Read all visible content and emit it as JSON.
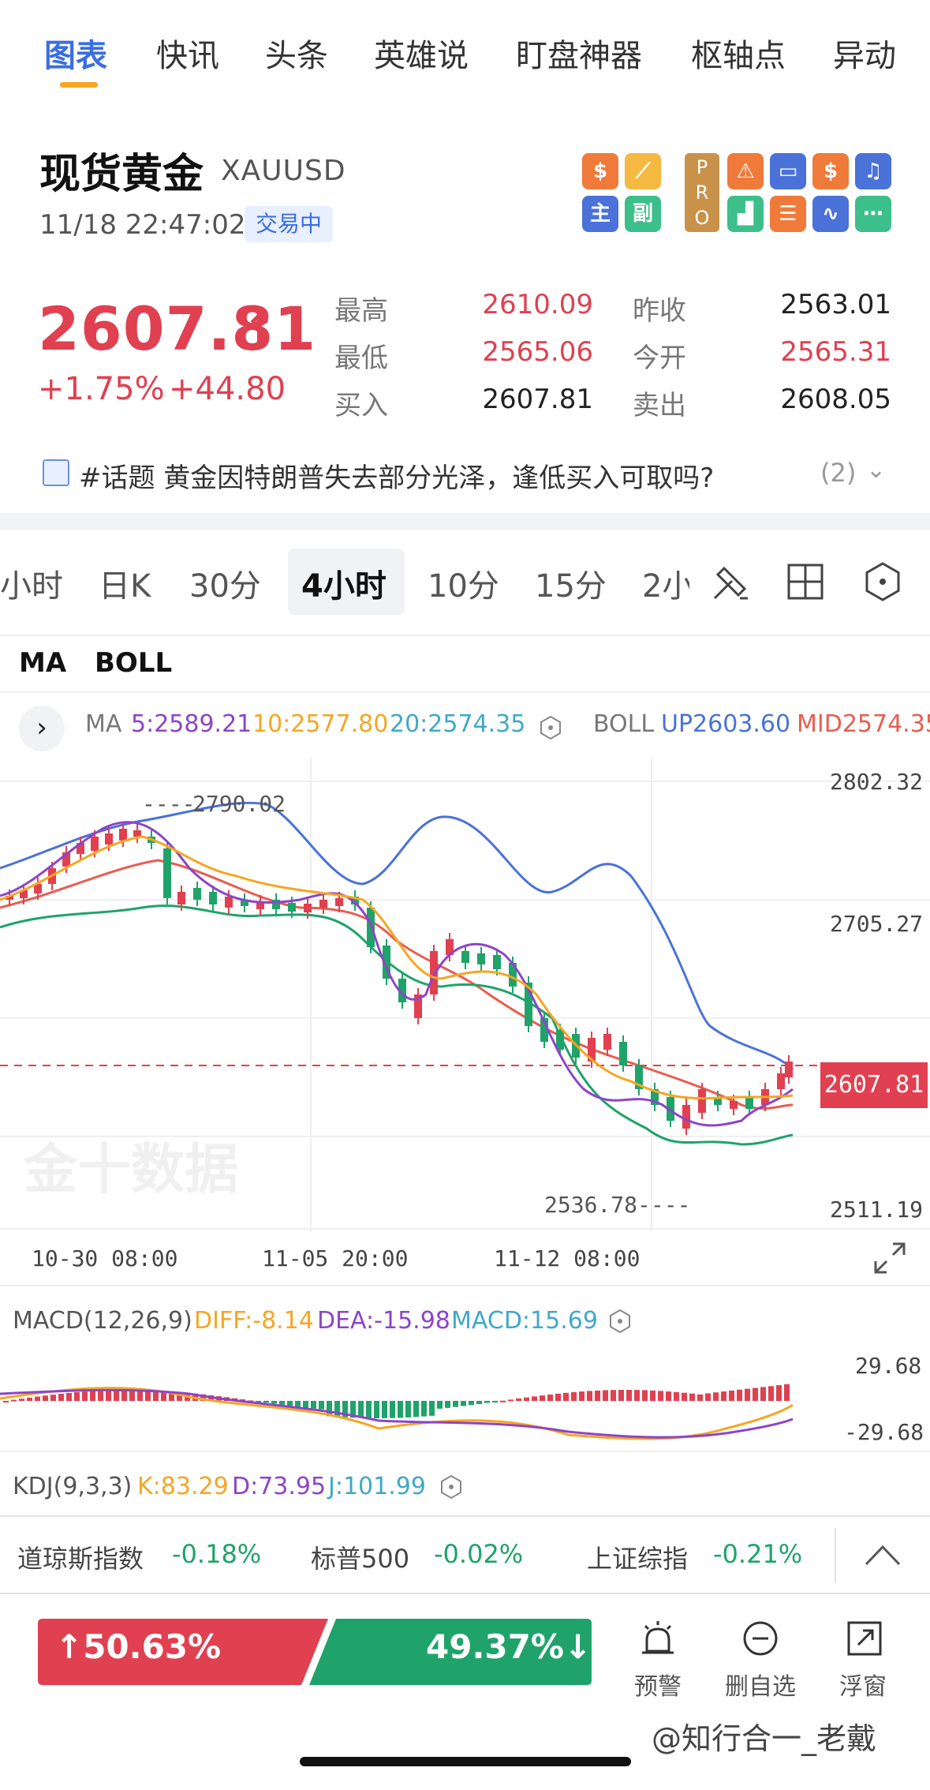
{
  "top_tabs": [
    "图表",
    "快讯",
    "头条",
    "英雄说",
    "盯盘神器",
    "枢轴点",
    "异动"
  ],
  "header": {
    "title": "现货黄金",
    "symbol": "XAUUSD",
    "datetime": "11/18 22:47:02",
    "status_badge": "交易中",
    "icon_tiles": [
      "dollar-icon",
      "pen-tool-icon",
      "chart-rise-icon",
      "chart-fall-icon",
      "pro-badge",
      "alarm-icon",
      "toggle-icon",
      "dollar-icon",
      "bell-icon",
      "bar-chart-icon",
      "list-icon",
      "pulse-icon",
      "more-icon"
    ],
    "pro_label": "PRO"
  },
  "quote": {
    "price": "2607.81",
    "change_pct": "+1.75%",
    "change_abs": "+44.80",
    "high_label": "最高",
    "high": "2610.09",
    "low_label": "最低",
    "low": "2565.06",
    "bid_label": "买入",
    "bid": "2607.81",
    "prev_close_label": "昨收",
    "prev_close": "2563.01",
    "open_label": "今开",
    "open": "2565.31",
    "ask_label": "卖出",
    "ask": "2608.05"
  },
  "topic": {
    "text": "#话题 黄金因特朗普失去部分光泽，逢低买入可取吗?",
    "count": "(2)"
  },
  "period_tabs": [
    "小时",
    "日K",
    "30分",
    "4小时",
    "10分",
    "15分",
    "2小"
  ],
  "active_period": "4小时",
  "indicator_tabs": [
    "MA",
    "BOLL"
  ],
  "ma_legend": {
    "prefix": "MA",
    "ma5": "5:2589.21",
    "ma10": "10:2577.80",
    "ma20": "20:2574.35"
  },
  "boll_legend": {
    "prefix": "BOLL",
    "up": "UP2603.60",
    "mid": "MID2574.35"
  },
  "chart_data": {
    "type": "candlestick",
    "price_axis_labels": [
      "2802.32",
      "2705.27",
      "2511.19"
    ],
    "current_price_tag": "2607.81",
    "high_marker": "2790.02",
    "low_marker": "2536.78",
    "x_labels": [
      "10-30 08:00",
      "11-05 20:00",
      "11-12 08:00"
    ],
    "y_range": [
      2511.19,
      2802.32
    ],
    "watermark": "金十数据",
    "colors": {
      "up": "#e04050",
      "down": "#1fa36a",
      "ma5": "#8e44c8",
      "ma10": "#f5a623",
      "ma20": "#3fa9c9",
      "boll_up": "#4a72d8",
      "boll_mid": "#e85d50",
      "boll_dn": "#1fa36a"
    }
  },
  "macd": {
    "label": "MACD(12,26,9)",
    "diff": "DIFF:-8.14",
    "dea": "DEA:-15.98",
    "macd": "MACD:15.69",
    "top": "29.68",
    "bottom": "-29.68"
  },
  "kdj": {
    "label": "KDJ(9,3,3)",
    "k": "K:83.29",
    "d": "D:73.95",
    "j": "J:101.99"
  },
  "tickers": [
    {
      "name": "道琼斯指数",
      "value": "-0.18%"
    },
    {
      "name": "标普500",
      "value": "-0.02%"
    },
    {
      "name": "上证综指",
      "value": "-0.21%"
    }
  ],
  "sentiment": {
    "bull": "50.63%",
    "bear": "49.37%"
  },
  "bottom_actions": [
    {
      "label": "预警",
      "icon": "alarm-icon"
    },
    {
      "label": "删自选",
      "icon": "remove-icon"
    },
    {
      "label": "浮窗",
      "icon": "float-window-icon"
    }
  ],
  "watermark_text": "@知行合一_老戴"
}
